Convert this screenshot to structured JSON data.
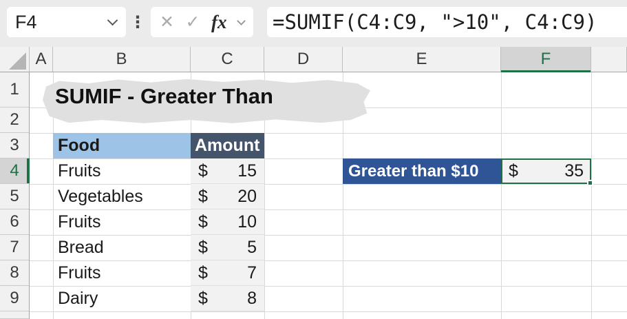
{
  "formula_bar": {
    "cell_reference": "F4",
    "formula": "=SUMIF(C4:C9, \">10\", C4:C9)",
    "fx_label": "fx"
  },
  "icons": {
    "cancel_icon": "✕",
    "enter_icon": "✓",
    "more_options_icon": "⋮"
  },
  "sheet": {
    "column_headers": [
      "A",
      "B",
      "C",
      "D",
      "E",
      "F"
    ],
    "row_headers": [
      "1",
      "2",
      "3",
      "4",
      "5",
      "6",
      "7",
      "8",
      "9"
    ],
    "selected_cell": "F4",
    "title": "SUMIF - Greater Than",
    "table": {
      "food_header": "Food",
      "amount_header": "Amount",
      "rows": [
        {
          "food": "Fruits",
          "currency": "$",
          "amount": "15"
        },
        {
          "food": "Vegetables",
          "currency": "$",
          "amount": "20"
        },
        {
          "food": "Fruits",
          "currency": "$",
          "amount": "10"
        },
        {
          "food": "Bread",
          "currency": "$",
          "amount": "5"
        },
        {
          "food": "Fruits",
          "currency": "$",
          "amount": "7"
        },
        {
          "food": "Dairy",
          "currency": "$",
          "amount": "8"
        }
      ]
    },
    "result": {
      "label": "Greater than $10",
      "currency": "$",
      "value": "35"
    }
  },
  "colors": {
    "selection_green": "#1E7145",
    "food_header_bg": "#9DC3E6",
    "amount_header_bg": "#44546A",
    "result_label_bg": "#2F5597",
    "shaded_cell_bg": "#F2F2F2",
    "title_highlight": "#E0E0E0"
  }
}
